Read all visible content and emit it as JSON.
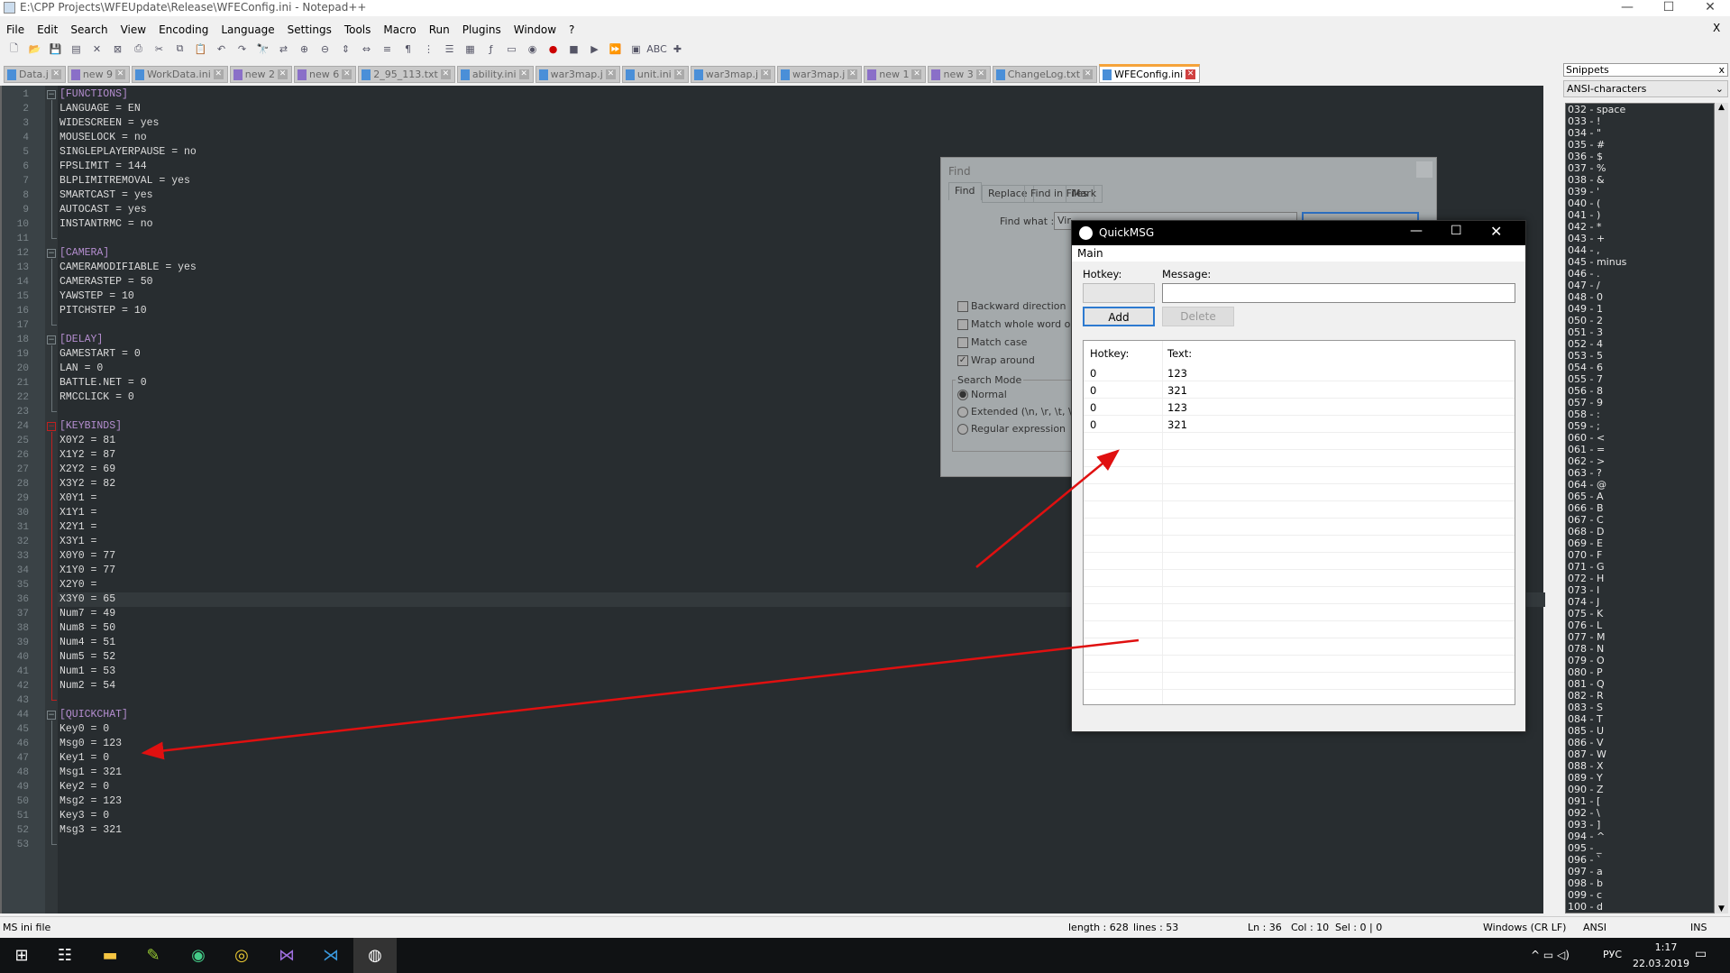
{
  "window": {
    "title": "E:\\CPP Projects\\WFEUpdate\\Release\\WFEConfig.ini - Notepad++",
    "close_x": "X"
  },
  "menu": [
    "File",
    "Edit",
    "Search",
    "View",
    "Encoding",
    "Language",
    "Settings",
    "Tools",
    "Macro",
    "Run",
    "Plugins",
    "Window",
    "?"
  ],
  "toolbar_icons": [
    "new-file",
    "open-file",
    "save",
    "save-all",
    "close",
    "close-all",
    "print",
    "cut",
    "copy",
    "paste",
    "undo",
    "redo",
    "find",
    "replace",
    "zoom-in",
    "zoom-out",
    "sync-v",
    "sync-h",
    "word-wrap",
    "show-all",
    "indent-guide",
    "udl",
    "doc-map",
    "function-list",
    "folder-workspace",
    "monitor",
    "record-macro",
    "stop-record",
    "play-macro",
    "run-macro-multiple",
    "save-macro",
    "spell-check",
    "plugin"
  ],
  "tabs": [
    {
      "label": "Data.j",
      "color": "#4a8fd8"
    },
    {
      "label": "new 9",
      "color": "#8a6fc8"
    },
    {
      "label": "WorkData.ini",
      "color": "#4a8fd8"
    },
    {
      "label": "new 2",
      "color": "#8a6fc8"
    },
    {
      "label": "new 6",
      "color": "#8a6fc8"
    },
    {
      "label": "2_95_113.txt",
      "color": "#4a8fd8"
    },
    {
      "label": "ability.ini",
      "color": "#4a8fd8"
    },
    {
      "label": "war3map.j",
      "color": "#4a8fd8"
    },
    {
      "label": "unit.ini",
      "color": "#4a8fd8"
    },
    {
      "label": "war3map.j",
      "color": "#4a8fd8"
    },
    {
      "label": "war3map.j",
      "color": "#4a8fd8"
    },
    {
      "label": "new 1",
      "color": "#8a6fc8"
    },
    {
      "label": "new 3",
      "color": "#8a6fc8"
    },
    {
      "label": "ChangeLog.txt",
      "color": "#4a8fd8"
    },
    {
      "label": "WFEConfig.ini",
      "color": "#4a8fd8",
      "active": true
    }
  ],
  "editor": {
    "current_line": 36,
    "lines": [
      "[FUNCTIONS]",
      "LANGUAGE = EN",
      "WIDESCREEN = yes",
      "MOUSELOCK = no",
      "SINGLEPLAYERPAUSE = no",
      "FPSLIMIT = 144",
      "BLPLIMITREMOVAL = yes",
      "SMARTCAST = yes",
      "AUTOCAST = yes",
      "INSTANTRMC = no",
      "",
      "[CAMERA]",
      "CAMERAMODIFIABLE = yes",
      "CAMERASTEP = 50",
      "YAWSTEP = 10",
      "PITCHSTEP = 10",
      "",
      "[DELAY]",
      "GAMESTART = 0",
      "LAN = 0",
      "BATTLE.NET = 0",
      "RMCCLICK = 0",
      "",
      "[KEYBINDS]",
      "X0Y2 = 81",
      "X1Y2 = 87",
      "X2Y2 = 69",
      "X3Y2 = 82",
      "X0Y1 =",
      "X1Y1 =",
      "X2Y1 =",
      "X3Y1 =",
      "X0Y0 = 77",
      "X1Y0 = 77",
      "X2Y0 =",
      "X3Y0 = 65",
      "Num7 = 49",
      "Num8 = 50",
      "Num4 = 51",
      "Num5 = 52",
      "Num1 = 53",
      "Num2 = 54",
      "",
      "[QUICKCHAT]",
      "Key0 = 0",
      "Msg0 = 123",
      "Key1 = 0",
      "Msg1 = 321",
      "Key2 = 0",
      "Msg2 = 123",
      "Key3 = 0",
      "Msg3 = 321",
      ""
    ]
  },
  "snippets": {
    "title": "Snippets",
    "close": "x",
    "category": "ANSI-characters",
    "items": [
      "032 - space",
      "033 - !",
      "034 - \"",
      "035 - #",
      "036 - $",
      "037 - %",
      "038 - &",
      "039 - '",
      "040 - (",
      "041 - )",
      "042 - *",
      "043 - +",
      "044 - ,",
      "045 - minus",
      "046 - .",
      "047 - /",
      "048 - 0",
      "049 - 1",
      "050 - 2",
      "051 - 3",
      "052 - 4",
      "053 - 5",
      "054 - 6",
      "055 - 7",
      "056 - 8",
      "057 - 9",
      "058 - :",
      "059 - ;",
      "060 - <",
      "061 - =",
      "062 - >",
      "063 - ?",
      "064 - @",
      "065 - A",
      "066 - B",
      "067 - C",
      "068 - D",
      "069 - E",
      "070 - F",
      "071 - G",
      "072 - H",
      "073 - I",
      "074 - J",
      "075 - K",
      "076 - L",
      "077 - M",
      "078 - N",
      "079 - O",
      "080 - P",
      "081 - Q",
      "082 - R",
      "083 - S",
      "084 - T",
      "085 - U",
      "086 - V",
      "087 - W",
      "088 - X",
      "089 - Y",
      "090 - Z",
      "091 - [",
      "092 - \\",
      "093 - ]",
      "094 - ^",
      "095 - _",
      "096 - `",
      "097 - a",
      "098 - b",
      "099 - c",
      "100 - d"
    ]
  },
  "find_dialog": {
    "title": "Find",
    "tabs": [
      "Find",
      "Replace",
      "Find in Files",
      "Mark"
    ],
    "find_what_label": "Find what :",
    "find_what_value": "Vir",
    "checkboxes": [
      {
        "label": "Backward direction",
        "checked": false
      },
      {
        "label": "Match whole word only",
        "checked": false
      },
      {
        "label": "Match case",
        "checked": false
      },
      {
        "label": "Wrap around",
        "checked": true
      }
    ],
    "search_mode_label": "Search Mode",
    "modes": [
      {
        "label": "Normal",
        "selected": true
      },
      {
        "label": "Extended (\\n, \\r, \\t, \\0,",
        "selected": false
      },
      {
        "label": "Regular expression",
        "selected": false
      }
    ]
  },
  "quickmsg": {
    "title": "QuickMSG",
    "menu": "Main",
    "hotkey_label": "Hotkey:",
    "message_label": "Message:",
    "hotkey_value": "",
    "message_value": "",
    "add": "Add",
    "delete": "Delete",
    "columns": [
      "Hotkey:",
      "Text:"
    ],
    "rows": [
      [
        "0",
        "123"
      ],
      [
        "0",
        "321"
      ],
      [
        "0",
        "123"
      ],
      [
        "0",
        "321"
      ]
    ]
  },
  "status": {
    "type": "MS ini file",
    "length": "length : 628",
    "lines": "lines : 53",
    "ln": "Ln : 36",
    "col": "Col : 10",
    "sel": "Sel : 0 | 0",
    "eol": "Windows (CR LF)",
    "enc": "ANSI",
    "mode": "INS"
  },
  "taskbar": {
    "lang": "РУС",
    "time": "1:17",
    "date": "22.03.2019"
  },
  "colors": {
    "arrow": "#e01010",
    "editor_bg": "#282d30",
    "section": "#b58ed0"
  }
}
